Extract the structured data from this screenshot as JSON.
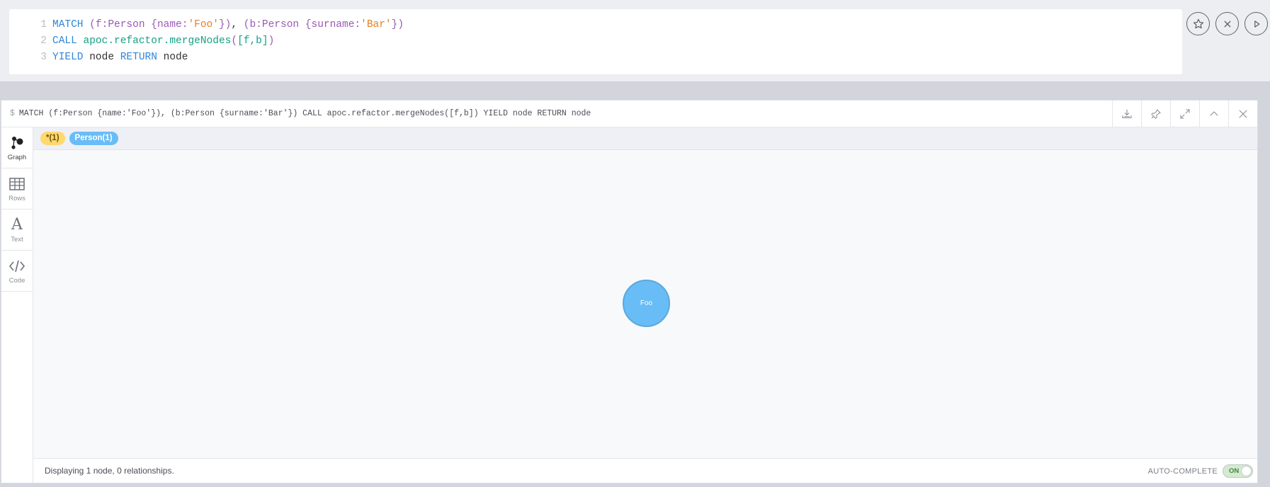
{
  "editor": {
    "lines": [
      {
        "num": "1",
        "t": [
          "MATCH",
          " (f:Person ",
          "{",
          "name",
          ":",
          "'Foo'",
          "}",
          ")",
          ", ",
          "(b:Person ",
          "{",
          "surname",
          ":",
          "'Bar'",
          "}",
          ")"
        ]
      },
      {
        "num": "2",
        "t": [
          "CALL",
          " ",
          "apoc.refactor.mergeNodes",
          "(",
          "[f,b]",
          ")"
        ]
      },
      {
        "num": "3",
        "t": [
          "YIELD",
          " node ",
          "RETURN",
          " node"
        ]
      }
    ],
    "actions": {
      "favorite": "star-icon",
      "clear": "close-circle-icon",
      "run": "play-icon"
    }
  },
  "frame": {
    "prompt": "$",
    "query": "MATCH (f:Person {name:'Foo'}), (b:Person {surname:'Bar'}) CALL apoc.refactor.mergeNodes([f,b]) YIELD node RETURN node",
    "tools": [
      "download-icon",
      "pin-icon",
      "expand-icon",
      "collapse-up-icon",
      "close-icon"
    ]
  },
  "sidebar": {
    "items": [
      {
        "label": "Graph",
        "icon": "graph-icon"
      },
      {
        "label": "Rows",
        "icon": "table-icon"
      },
      {
        "label": "Text",
        "icon": "text-icon",
        "glyph": "A"
      },
      {
        "label": "Code",
        "icon": "code-icon"
      }
    ]
  },
  "legend": {
    "all": "*(1)",
    "person": "Person(1)"
  },
  "graph": {
    "node_caption": "Foo",
    "node_color": "#68bdf6"
  },
  "footer": {
    "status": "Displaying 1 node, 0 relationships.",
    "autocomplete_label": "AUTO-COMPLETE",
    "toggle_state": "ON"
  },
  "colors": {
    "keyword": "#2f86d8",
    "string": "#e67e22",
    "function": "#15a085",
    "pattern": "#9b59b6"
  }
}
